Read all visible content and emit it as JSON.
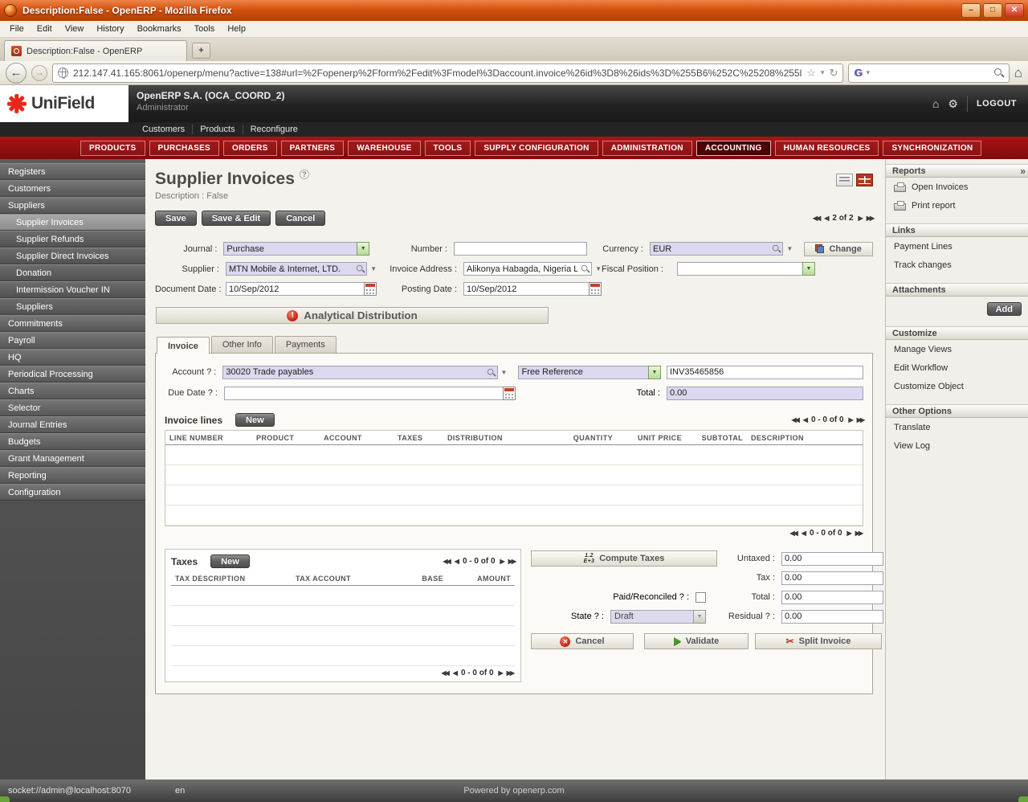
{
  "browser": {
    "window_title": "Description:False - OpenERP - Mozilla Firefox",
    "menu_items": [
      "File",
      "Edit",
      "View",
      "History",
      "Bookmarks",
      "Tools",
      "Help"
    ],
    "tab_title": "Description:False - OpenERP",
    "new_tab_label": "+",
    "url": "212.147.41.165:8061/openerp/menu?active=138#url=%2Fopenerp%2Fform%2Fedit%3Fmodel%3Daccount.invoice%26id%3D8%26ids%3D%255B6%252C%25208%255l",
    "search_engine": "Google"
  },
  "app_header": {
    "logo_text": "UniField",
    "company": "OpenERP S.A. (OCA_COORD_2)",
    "user": "Administrator",
    "logout_label": "LOGOUT",
    "shortcuts": [
      "Customers",
      "Products",
      "Reconfigure"
    ]
  },
  "main_nav": {
    "items": [
      "PRODUCTS",
      "PURCHASES",
      "ORDERS",
      "PARTNERS",
      "WAREHOUSE",
      "TOOLS",
      "SUPPLY CONFIGURATION",
      "ADMINISTRATION",
      "ACCOUNTING",
      "HUMAN RESOURCES",
      "SYNCHRONIZATION"
    ],
    "active": "ACCOUNTING"
  },
  "sidebar": {
    "selected": "Supplier Invoices",
    "items": [
      {
        "label": "Registers"
      },
      {
        "label": "Customers"
      },
      {
        "label": "Suppliers"
      },
      {
        "label": "Supplier Invoices"
      },
      {
        "label": "Supplier Refunds"
      },
      {
        "label": "Supplier Direct Invoices"
      },
      {
        "label": "Donation"
      },
      {
        "label": "Intermission Voucher IN"
      },
      {
        "label": "Suppliers"
      },
      {
        "label": "Commitments"
      },
      {
        "label": "Payroll"
      },
      {
        "label": "HQ"
      },
      {
        "label": "Periodical Processing"
      },
      {
        "label": "Charts"
      },
      {
        "label": "Selector"
      },
      {
        "label": "Journal Entries"
      },
      {
        "label": "Budgets"
      },
      {
        "label": "Grant Management"
      },
      {
        "label": "Reporting"
      },
      {
        "label": "Configuration"
      }
    ]
  },
  "form": {
    "title": "Supplier Invoices",
    "help_icon": "?",
    "subtitle": "Description : False",
    "save_label": "Save",
    "save_edit_label": "Save & Edit",
    "cancel_label": "Cancel",
    "pager": "2 of 2",
    "journal_label": "Journal :",
    "journal_value": "Purchase",
    "number_label": "Number :",
    "number_value": "",
    "currency_label": "Currency :",
    "currency_value": "EUR",
    "change_label": "Change",
    "supplier_label": "Supplier :",
    "supplier_value": "MTN Mobile & Internet, LTD.",
    "invoice_address_label": "Invoice Address :",
    "invoice_address_value": "Alikonya Habagda, Nigeria L",
    "fiscal_position_label": "Fiscal Position :",
    "fiscal_position_value": "",
    "document_date_label": "Document Date :",
    "document_date_value": "10/Sep/2012",
    "posting_date_label": "Posting Date :",
    "posting_date_value": "10/Sep/2012",
    "analytical_label": "Analytical Distribution",
    "tabs": [
      "Invoice",
      "Other Info",
      "Payments"
    ]
  },
  "invoice_tab": {
    "account_label": "Account ? :",
    "account_value": "30020 Trade payables",
    "reference_type_value": "Free Reference",
    "reference_value": "INV35465856",
    "due_date_label": "Due Date ? :",
    "due_date_value": "",
    "total_label": "Total :",
    "total_value": "0.00",
    "invoice_lines": {
      "title": "Invoice lines",
      "new_label": "New",
      "pager": "0 - 0 of 0",
      "columns": [
        "LINE NUMBER",
        "PRODUCT",
        "ACCOUNT",
        "TAXES",
        "DISTRIBUTION",
        "QUANTITY",
        "UNIT PRICE",
        "SUBTOTAL",
        "DESCRIPTION"
      ]
    },
    "taxes": {
      "title": "Taxes",
      "new_label": "New",
      "pager": "0 - 0 of 0",
      "columns": [
        "TAX DESCRIPTION",
        "TAX ACCOUNT",
        "BASE",
        "AMOUNT"
      ]
    },
    "totals": {
      "compute_label": "Compute Taxes",
      "compute_icon_top": "1.2",
      "compute_icon_bottom": "E+3",
      "untaxed_label": "Untaxed :",
      "untaxed_value": "0.00",
      "tax_label": "Tax :",
      "tax_value": "0.00",
      "paid_label": "Paid/Reconciled ? :",
      "total_label": "Total :",
      "total_value": "0.00",
      "state_label": "State ? :",
      "state_value": "Draft",
      "residual_label": "Residual ? :",
      "residual_value": "0.00"
    },
    "actions": {
      "cancel_label": "Cancel",
      "validate_label": "Validate",
      "split_label": "Split Invoice"
    }
  },
  "right_panel": {
    "collapse_icon": "»",
    "sections": [
      {
        "title": "Reports",
        "items": [
          "Open Invoices",
          "Print report"
        ]
      },
      {
        "title": "Links",
        "items": [
          "Payment Lines",
          "Track changes"
        ]
      },
      {
        "title": "Attachments",
        "items": [],
        "button_label": "Add"
      },
      {
        "title": "Customize",
        "items": [
          "Manage Views",
          "Edit Workflow",
          "Customize Object"
        ]
      },
      {
        "title": "Other Options",
        "items": [
          "Translate",
          "View Log"
        ]
      }
    ]
  },
  "statusbar": {
    "connection": "socket://admin@localhost:8070",
    "lang": "en",
    "powered": "Powered by openerp.com"
  }
}
